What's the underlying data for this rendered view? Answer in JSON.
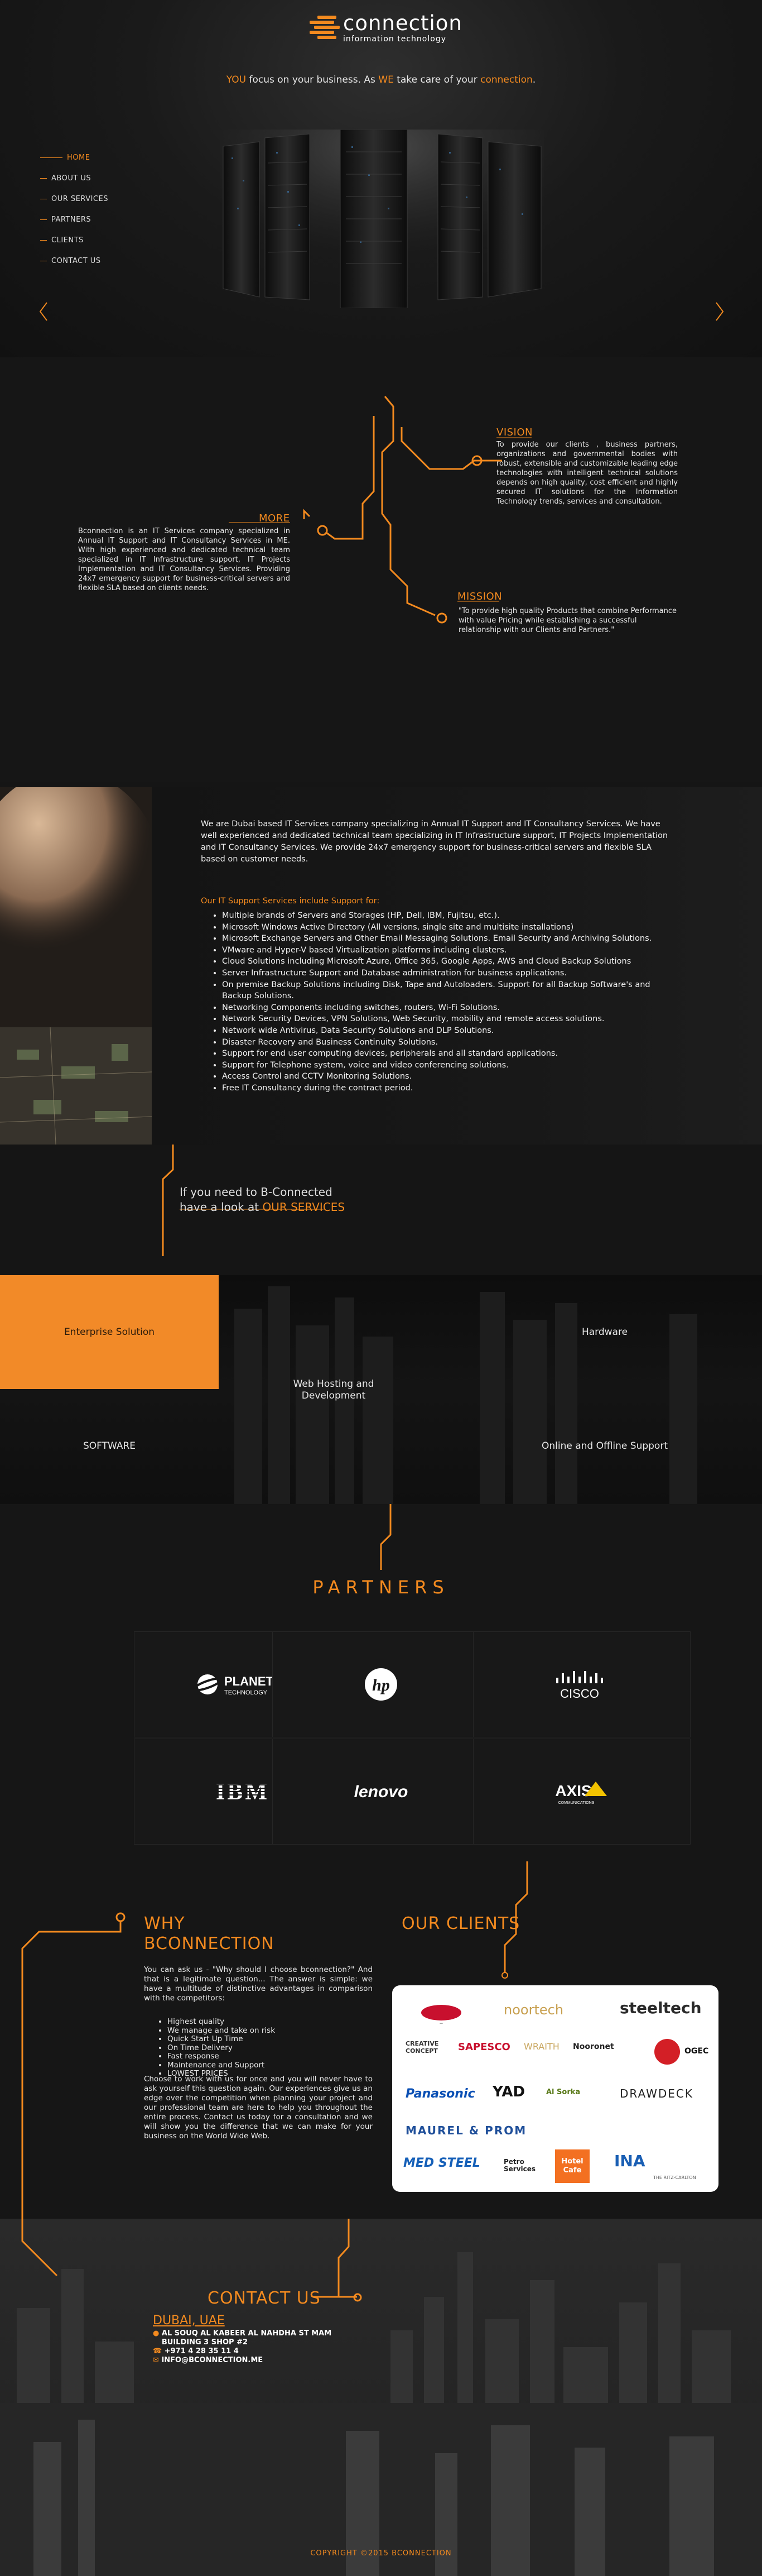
{
  "brand": {
    "name": "connection",
    "tagline": "information technology",
    "accent_color": "#f38a1f"
  },
  "hero": {
    "tagline_parts": [
      "YOU",
      " focus on your business. As ",
      "WE",
      " take care of your ",
      "connection",
      "."
    ],
    "prev_icon": "chevron-left-icon",
    "next_icon": "chevron-right-icon"
  },
  "nav": {
    "items": [
      "HOME",
      "ABOUT US",
      "OUR SERVICES",
      "PARTNERS",
      "CLIENTS",
      "CONTACT US"
    ],
    "active_index": 0
  },
  "about": {
    "vision": {
      "title": "VISION",
      "text": "To provide our clients , business partners, organizations and governmental bodies with robust, extensible and customizable leading edge technologies with intelligent technical solutions depends on high quality, cost efficient and highly secured IT solutions for the Information Technology trends, services and consultation."
    },
    "more": {
      "title": "MORE",
      "text": "Bconnection is an IT Services company specialized in Annual IT Support and IT Consultancy Services in ME. With high experienced and dedicated technical team specialized in IT Infrastructure support, IT Projects Implementation and IT Consultancy Services. Providing 24x7 emergency support for business-critical servers and flexible SLA based on clients needs."
    },
    "mission": {
      "title": "MISSION",
      "text": "\"To provide high quality Products that combine Performance with value Pricing while establishing a successful relationship with our Clients and Partners.\""
    }
  },
  "services": {
    "intro": "We are Dubai based IT Services company specializing in Annual IT Support and IT Consultancy Services. We have well experienced and dedicated technical team specializing in IT Infrastructure support, IT Projects Implementation and IT Consultancy Services. We provide 24x7 emergency support for business-critical servers and flexible SLA based on customer needs.",
    "heading": "Our IT Support Services include Support for:",
    "items": [
      "Multiple brands of Servers and Storages (HP, Dell, IBM, Fujitsu, etc.).",
      "Microsoft Windows Active Directory (All versions, single site and multisite installations)",
      "Microsoft Exchange Servers and Other Email Messaging Solutions. Email Security and Archiving Solutions.",
      "VMware and Hyper-V based Virtualization platforms including clusters.",
      "Cloud Solutions including Microsoft Azure, Office 365, Google Apps, AWS and Cloud Backup Solutions",
      "Server Infrastructure Support and Database administration for business applications.",
      "On premise Backup Solutions including Disk, Tape and Autoloaders. Support for all Backup Software's and Backup Solutions.",
      "Networking Components including switches, routers, Wi-Fi Solutions.",
      "Network Security Devices, VPN Solutions, Web Security, mobility and remote access solutions.",
      "Network wide Antivirus, Data Security Solutions and DLP Solutions.",
      "Disaster Recovery and Business Continuity Solutions.",
      "Support for end user computing devices, peripherals and all standard applications.",
      "Support for Telephone system, voice and video conferencing solutions.",
      "Access Control and CCTV Monitoring Solutions.",
      "Free IT Consultancy during the contract period."
    ]
  },
  "connected": {
    "line1": "If you need to B-Connected",
    "line2_prefix": "have a look at ",
    "line2_link": "OUR SERVICES"
  },
  "tiles": {
    "items": [
      "Enterprise Solution",
      "Hardware",
      "Web Hosting and Development",
      "SOFTWARE",
      "Online and Offline Support"
    ],
    "active": "Enterprise Solution"
  },
  "partners": {
    "title": "PARTNERS",
    "logos": [
      "PLANET TECHNOLOGY",
      "hp",
      "CISCO",
      "IBM",
      "lenovo",
      "AXIS"
    ],
    "planet_top": "PLANET",
    "planet_bottom": "TECHNOLOGY",
    "axis_sub": "COMMUNICATIONS"
  },
  "why": {
    "title_line1": "WHY",
    "title_line2": "BCONNECTION",
    "intro": "You can ask us - \"Why should I choose bconnection?\" And that is a legitimate question... The answer is simple: we have a multitude of distinctive advantages in comparison with the competitors:",
    "points": [
      "Highest quality",
      "We manage and take on risk",
      "Quick Start Up Time",
      "On Time Delivery",
      "Fast response",
      "Maintenance and Support",
      "LOWEST PRICES"
    ],
    "outro": "Choose to work with us for once and you will never have to ask yourself this question again. Our experiences give us an edge over the competition when planning your project and our professional team are here to help you throughout the entire process. Contact us today for a consultation and we will show you the difference that we can make for your business on the World Wide Web."
  },
  "clients": {
    "title": "OUR CLIENTS",
    "logos": [
      "noortech",
      "steeltech",
      "CREATIVE CONCEPT",
      "SAPESCO",
      "WRAITH",
      "Nooronet",
      "OGEC",
      "Panasonic",
      "YAD",
      "Al Sorka",
      "DRAWDECK",
      "MAUREL & PROM",
      "MED STEEL",
      "Petro Services",
      "Hotel Cafe",
      "INA",
      "THE RITZ-CARLTON"
    ]
  },
  "contact": {
    "title": "CONTACT US",
    "city": "DUBAI, UAE",
    "address": "AL SOUQ AL KABEER AL NAHDHA ST MAM BUILDING 3 SHOP #2",
    "phone": "+971 4 28 35 11 4",
    "email": "INFO@BCONNECTION.ME",
    "pin_icon": "location-pin-icon",
    "phone_icon": "phone-icon",
    "email_icon": "email-icon"
  },
  "footer": {
    "copyright": "COPYRIGHT ©2015 BCONNECTION"
  }
}
